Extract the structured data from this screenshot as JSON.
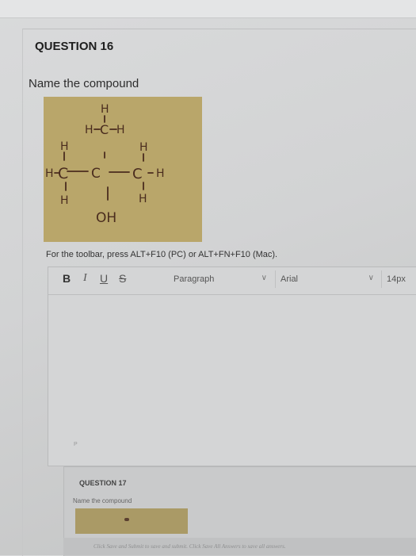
{
  "question": {
    "title": "QUESTION 16",
    "prompt": "Name the compound",
    "structure": {
      "atoms": {
        "h_top": "H",
        "h_upper_left": "H",
        "c_upper": "C",
        "h_upper_right": "H",
        "h_left_top": "H",
        "h_left": "H",
        "c_left": "C",
        "c_center": "C",
        "c_right": "C",
        "h_right": "H",
        "h_left_bottom": "H",
        "h_right_top": "H",
        "h_right_bottom": "H",
        "oh": "OH"
      },
      "background_color": "#b9a66a",
      "ink_color": "#4a2c1e"
    }
  },
  "editor": {
    "toolbar_hint": "For the toolbar, press ALT+F10 (PC) or ALT+FN+F10 (Mac).",
    "bold": "B",
    "italic": "I",
    "underline": "U",
    "strike": "S",
    "paragraph_select": "Paragraph",
    "font_select": "Arial",
    "size_select": "14px",
    "path_marker": "P"
  },
  "next_question": {
    "title": "QUESTION 17",
    "prompt": "Name the compound"
  },
  "footer": {
    "text": "Click Save and Submit to save and submit. Click Save All Answers to save all answers."
  }
}
